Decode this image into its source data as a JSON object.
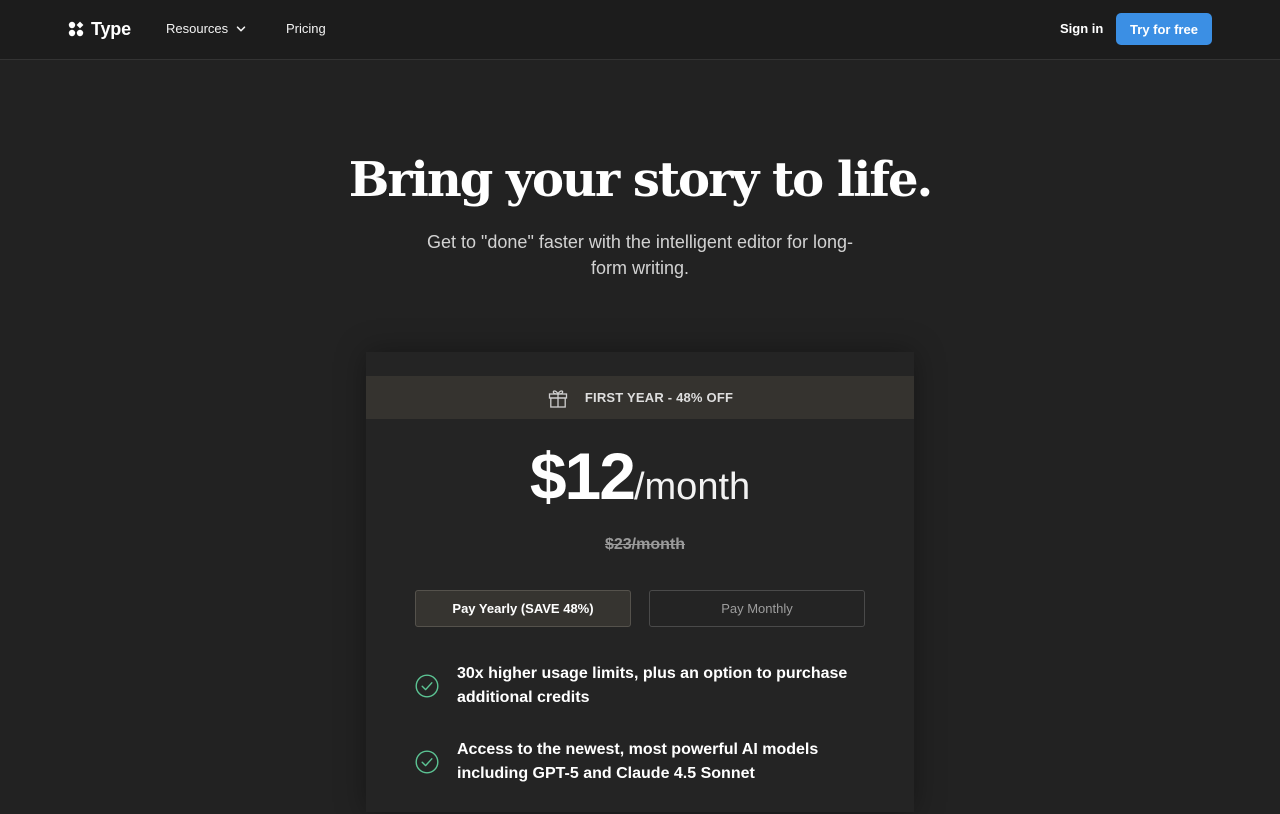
{
  "header": {
    "logo_text": "Type",
    "nav": {
      "resources_label": "Resources",
      "pricing_label": "Pricing"
    },
    "signin_label": "Sign in",
    "cta_label": "Try for free"
  },
  "hero": {
    "title": "Bring your story to life.",
    "subtitle": "Get to \"done\" faster with the intelligent editor for long-form writing."
  },
  "pricing_card": {
    "promo_text": "FIRST YEAR - 48% OFF",
    "price_amount": "$12",
    "price_period": "/month",
    "old_price": "$23/month",
    "toggle": {
      "yearly_label": "Pay Yearly (SAVE 48%)",
      "monthly_label": "Pay Monthly",
      "selected": "yearly"
    },
    "features": [
      "30x higher usage limits, plus an option to purchase additional credits",
      "Access to the newest, most powerful AI models including GPT-5 and Claude 4.5 Sonnet"
    ]
  },
  "icons": {
    "logo": "logo-icon",
    "resources_dropdown": "chevron-down-icon",
    "promo": "gift-icon",
    "feature": "check-circle-icon"
  },
  "colors": {
    "background": "#222222",
    "header_background": "#1c1c1c",
    "accent": "#3b8fe4",
    "promo_bar": "#35332f",
    "check": "#5cc494"
  }
}
